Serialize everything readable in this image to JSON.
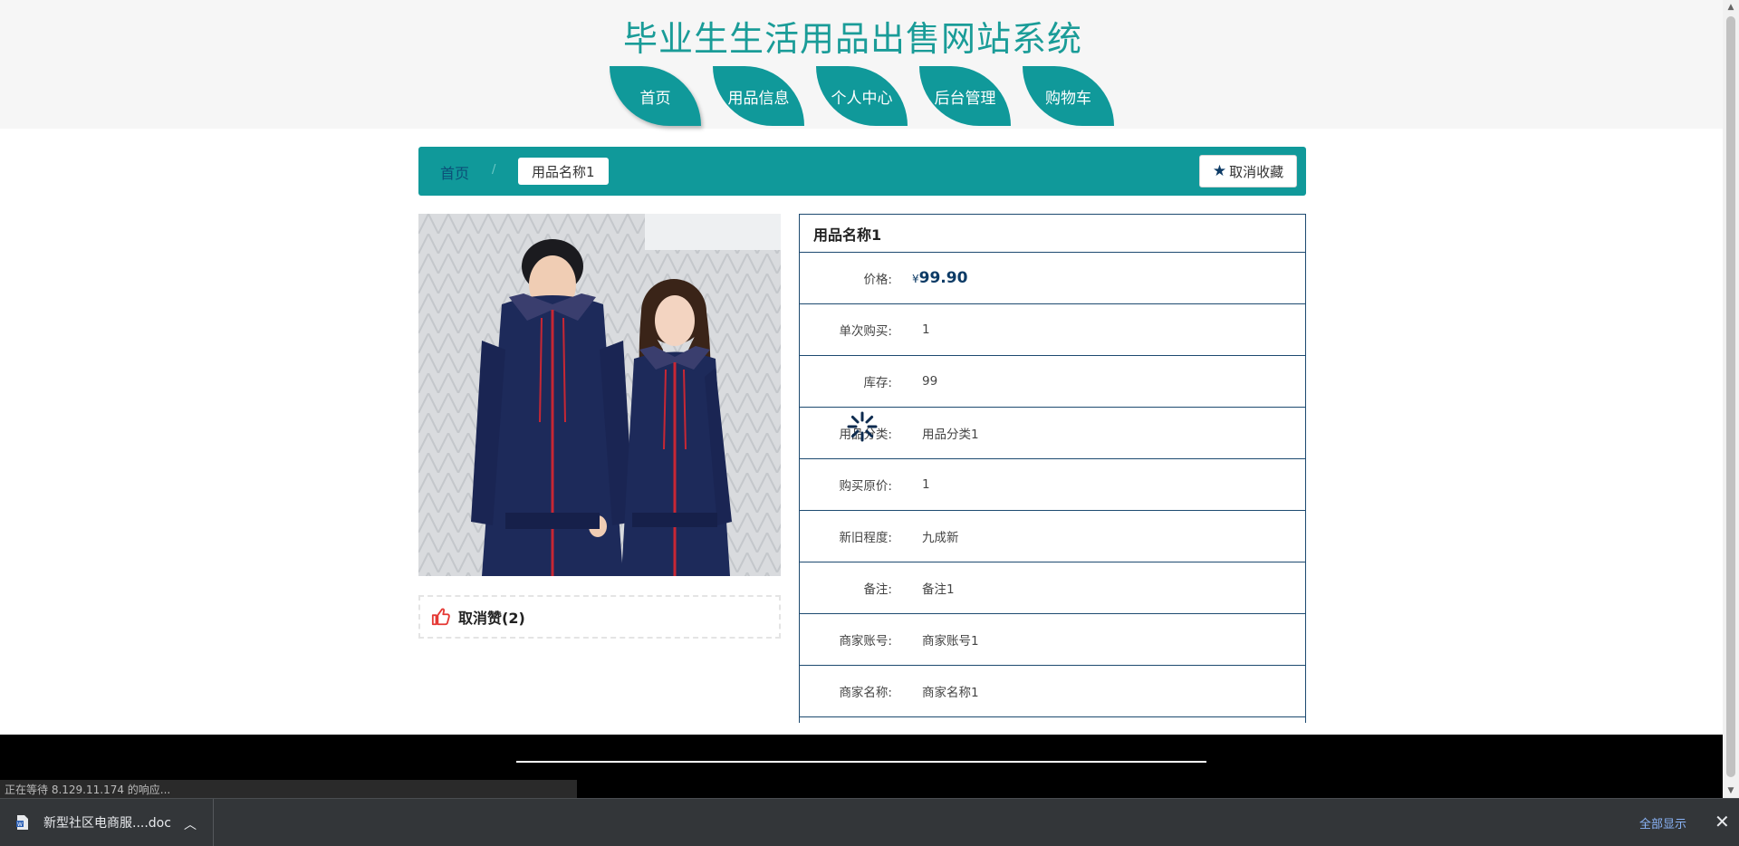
{
  "header": {
    "title": "毕业生生活用品出售网站系统",
    "nav": [
      "首页",
      "用品信息",
      "个人中心",
      "后台管理",
      "购物车"
    ]
  },
  "breadcrumb": {
    "home": "首页",
    "separator": "/",
    "current": "用品名称1"
  },
  "favorite_button": "取消收藏",
  "like": {
    "label": "取消赞(2)"
  },
  "product": {
    "name": "用品名称1",
    "price_label": "价格:",
    "currency": "¥",
    "price": "99.90",
    "rows": [
      {
        "label": "单次购买:",
        "value": "1"
      },
      {
        "label": "库存:",
        "value": "99"
      },
      {
        "label": "用品分类:",
        "value": "用品分类1"
      },
      {
        "label": "购买原价:",
        "value": "1"
      },
      {
        "label": "新旧程度:",
        "value": "九成新"
      },
      {
        "label": "备注:",
        "value": "备注1"
      },
      {
        "label": "商家账号:",
        "value": "商家账号1"
      },
      {
        "label": "商家名称:",
        "value": "商家名称1"
      }
    ]
  },
  "status_bar": "正在等待 8.129.11.174 的响应...",
  "downloads": {
    "file_name": "新型社区电商服....doc",
    "show_all": "全部显示"
  },
  "colors": {
    "brand": "#10999a",
    "title": "#1a9c98",
    "accent_navy": "#0d3b66"
  }
}
